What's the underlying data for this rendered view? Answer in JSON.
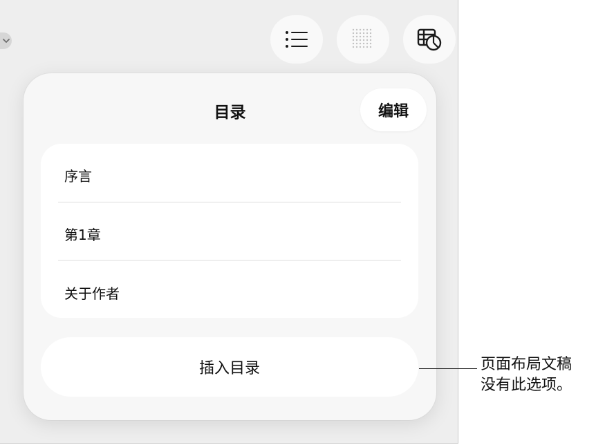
{
  "toolbar": {
    "buttons": [
      {
        "icon": "list-icon"
      },
      {
        "icon": "dot-grid-icon"
      },
      {
        "icon": "table-chart-icon"
      }
    ]
  },
  "popover": {
    "title": "目录",
    "edit_label": "编辑",
    "items": [
      {
        "label": "序言"
      },
      {
        "label": "第1章"
      },
      {
        "label": "关于作者"
      }
    ],
    "insert_label": "插入目录"
  },
  "callout": {
    "line1": "页面布局文稿",
    "line2": "没有此选项。"
  },
  "colors": {
    "background": "#eeeeee",
    "popover": "#f7f7f7",
    "card": "#ffffff",
    "text": "#111111"
  }
}
